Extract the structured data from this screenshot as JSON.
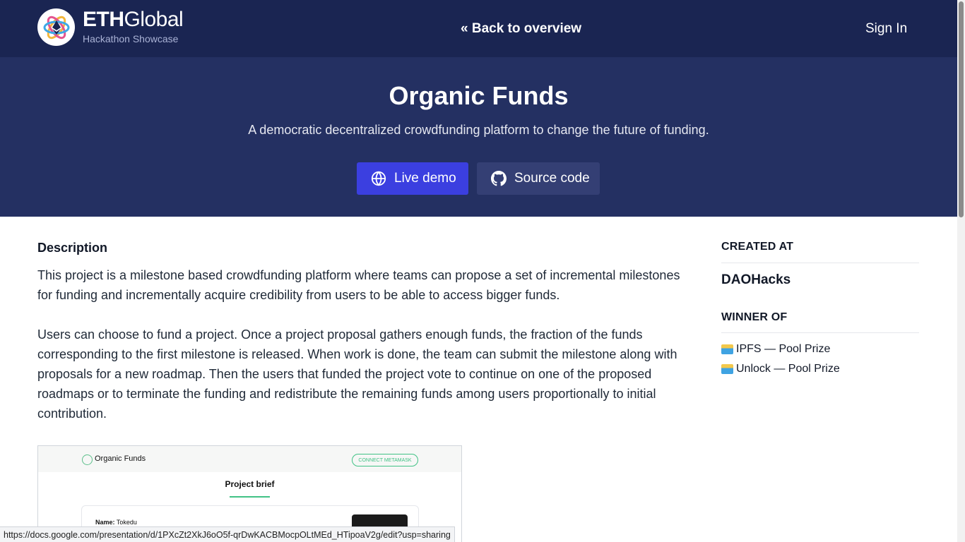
{
  "header": {
    "brand_bold": "ETH",
    "brand_light": "Global",
    "brand_subtitle": "Hackathon Showcase",
    "back_link": "« Back to overview",
    "sign_in": "Sign In",
    "logo_icon": "ethglobal-logo-icon"
  },
  "hero": {
    "title": "Organic Funds",
    "subtitle": "A democratic decentralized crowdfunding platform to change the future of funding.",
    "live_demo_label": "Live demo",
    "live_demo_icon": "globe-icon",
    "source_code_label": "Source code",
    "source_code_icon": "github-icon",
    "colors": {
      "header_bg": "#1a2552",
      "hero_bg": "#243062",
      "demo_btn": "#3b3fe0",
      "source_btn": "#343f74"
    }
  },
  "description": {
    "heading": "Description",
    "paragraphs": [
      "This project is a milestone based crowdfunding platform where teams can propose a set of incremental milestones for funding and incrementally acquire credibility from users to be able to access bigger funds.",
      "Users can choose to fund a project. Once a project proposal gathers enough funds, the fraction of the funds corresponding to the first milestone is released. When work is done, the team can submit the milestone along with proposals for a new roadmap. Then the users that funded the project vote to continue on one of the proposed roadmaps or to terminate the funding and redistribute the remaining funds among users proportionally to initial contribution."
    ]
  },
  "screenshot_preview": {
    "app_name": "Organic Funds",
    "connect_button": "CONNECT METAMASK",
    "section_title": "Project brief",
    "name_label": "Name:",
    "name_value": "Tokedu"
  },
  "sidebar": {
    "created_at_heading": "CREATED AT",
    "event_name": "DAOHacks",
    "winner_heading": "WINNER OF",
    "prizes": [
      {
        "label": "IPFS — Pool Prize",
        "icon": "pool-prize-icon"
      },
      {
        "label": "Unlock — Pool Prize",
        "icon": "pool-prize-icon"
      }
    ]
  },
  "status_bar": {
    "url": "https://docs.google.com/presentation/d/1PXcZt2XkJ6oO5f-qrDwKACBMocpOLtMEd_HTipoaV2g/edit?usp=sharing"
  }
}
